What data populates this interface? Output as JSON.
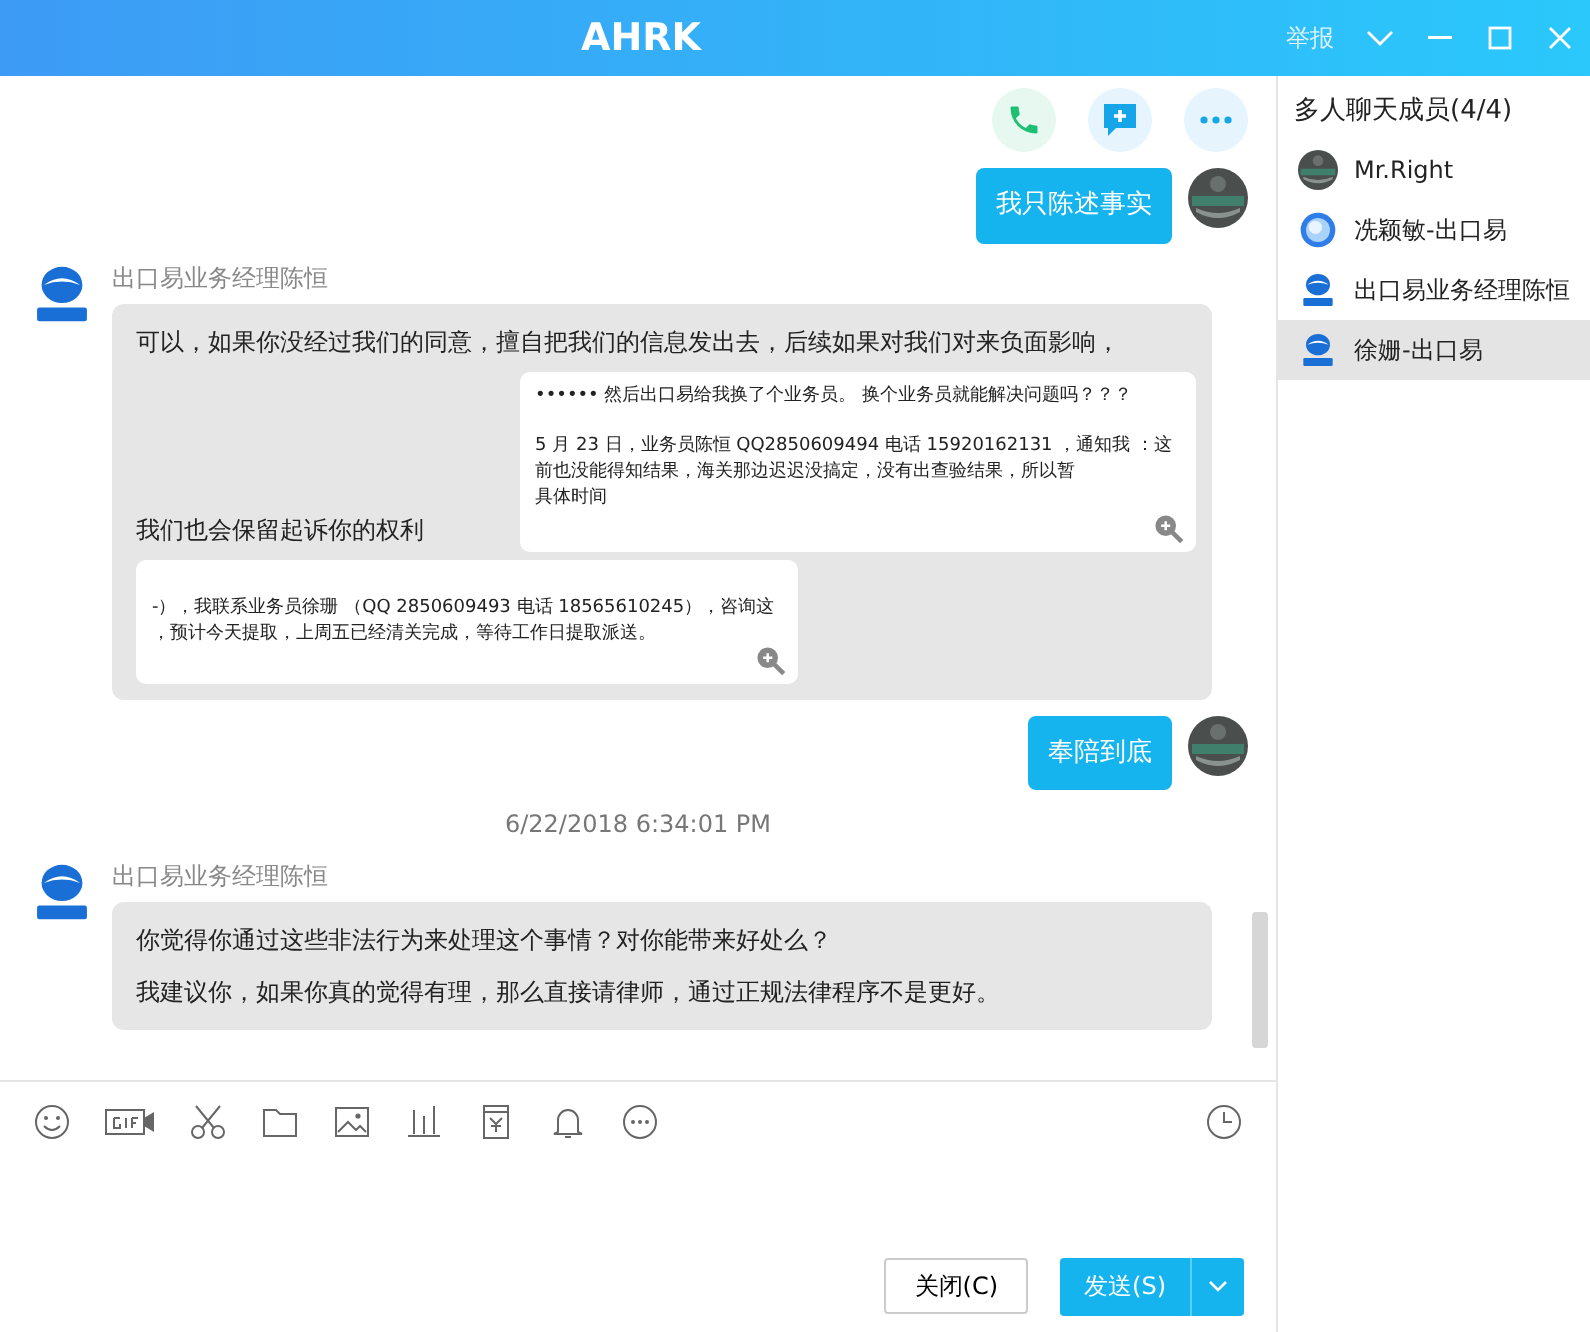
{
  "window": {
    "title": "AHRK",
    "report": "举报"
  },
  "messages": [
    {
      "kind": "outgoing",
      "text": "我只陈述事实"
    },
    {
      "kind": "incoming",
      "sender": "出口易业务经理陈恒",
      "parts": [
        {
          "kind": "text",
          "text": "可以，如果你没经过我们的同意，擅自把我们的信息发出去，后续如果对我们对来负面影响，"
        },
        {
          "kind": "text",
          "text": "我们也会保留起诉你的权利"
        },
        {
          "kind": "image",
          "paragraphs": [
            [
              "•••••• 然后出口易给我换了个业务员。  换个业务员就能解决问题吗？？？"
            ],
            [
              "5 月 23 日，业务员陈恒  QQ2850609494 电话  15920162131  ，通知我 ：这",
              "前也没能得知结果，海关那边迟迟没搞定，没有出查验结果，所以暂",
              "具体时间"
            ]
          ]
        },
        {
          "kind": "image",
          "paragraphs": [
            [
              "-），我联系业务员徐珊 （QQ 2850609493  电话  18565610245），咨询这",
              "，预计今天提取，上周五已经清关完成，等待工作日提取派送。"
            ]
          ]
        }
      ]
    },
    {
      "kind": "outgoing",
      "text": "奉陪到底"
    },
    {
      "kind": "timestamp",
      "text": "6/22/2018 6:34:01 PM"
    },
    {
      "kind": "incoming",
      "sender": "出口易业务经理陈恒",
      "parts": [
        {
          "kind": "text",
          "text": "你觉得你通过这些非法行为来处理这个事情？对你能带来好处么？"
        },
        {
          "kind": "text",
          "text": "我建议你，如果你真的觉得有理，那么直接请律师，通过正规法律程序不是更好。"
        }
      ]
    }
  ],
  "members_panel": {
    "title": "多人聊天成员(4/4)",
    "members": [
      {
        "name": "Mr.Right",
        "kind": "photo",
        "selected": false
      },
      {
        "name": "冼颖敏-出口易",
        "kind": "globe",
        "selected": false
      },
      {
        "name": "出口易业务经理陈恒",
        "kind": "logo",
        "selected": false
      },
      {
        "name": "徐姗-出口易",
        "kind": "logo",
        "selected": true
      }
    ]
  },
  "buttons": {
    "close": "关闭(C)",
    "send": "发送(S)"
  }
}
